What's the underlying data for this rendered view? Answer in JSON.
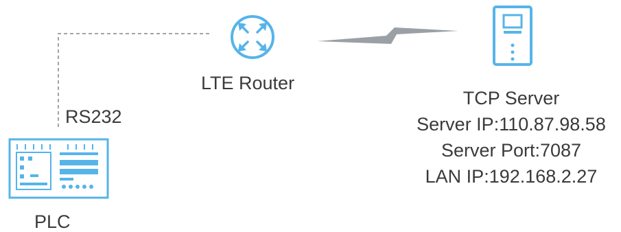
{
  "router": {
    "label": "LTE Router",
    "icon": "router-icon"
  },
  "serial_link": {
    "label": "RS232"
  },
  "plc": {
    "label": "PLC",
    "icon": "plc-icon"
  },
  "server": {
    "icon": "server-icon",
    "title": "TCP Server",
    "ip_line": "Server IP:110.87.98.58",
    "port_line": "Server Port:7087",
    "lan_line": "LAN IP:192.168.2.27"
  },
  "colors": {
    "accent": "#56b4e9",
    "link": "#9aa0a6",
    "text": "#3a3a3a"
  }
}
